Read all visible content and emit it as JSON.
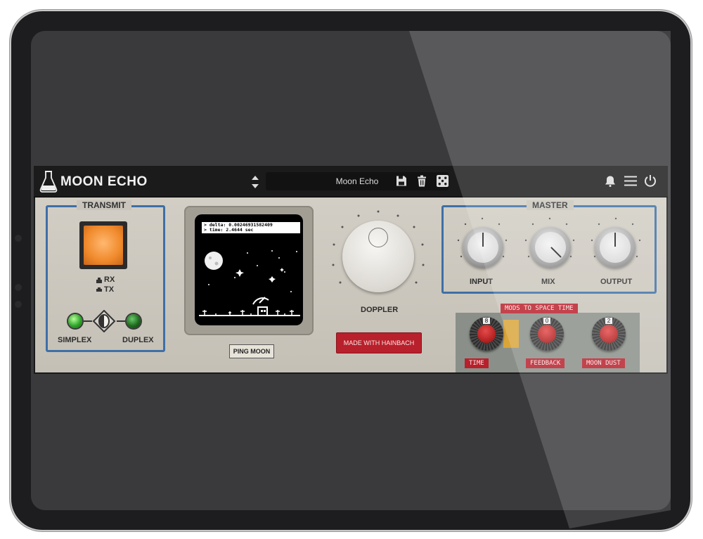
{
  "app": {
    "title": "MOON ECHO",
    "preset_name": "Moon Echo",
    "colors": {
      "accent_blue": "#3e6fa6",
      "red": "#b8202b",
      "orange": "#f08a2c",
      "led_green": "#2fa52a"
    },
    "toolbar_icons": [
      "save-icon",
      "trash-icon",
      "dice-icon",
      "bell-icon",
      "menu-icon",
      "power-icon"
    ]
  },
  "transmit": {
    "title": "TRANSMIT",
    "rx_label": "RX",
    "tx_label": "TX",
    "simplex_label": "SIMPLEX",
    "duplex_label": "DUPLEX"
  },
  "display": {
    "line1": "> delta: 0.00246931582409",
    "line2": "> time: 2.4644 sec",
    "ping_label": "PING MOON"
  },
  "doppler": {
    "label": "DOPPLER",
    "credit_label": "MADE WITH HAINBACH"
  },
  "master": {
    "title": "MASTER",
    "knobs": [
      {
        "label": "INPUT"
      },
      {
        "label": "MIX"
      },
      {
        "label": "OUTPUT"
      }
    ]
  },
  "mods": {
    "title": "MODS TO SPACE TIME",
    "knobs": [
      {
        "label": "TIME",
        "dial_value": "8"
      },
      {
        "label": "FEEDBACK",
        "dial_value": "0"
      },
      {
        "label": "MOON DUST",
        "dial_value": "2"
      }
    ]
  }
}
